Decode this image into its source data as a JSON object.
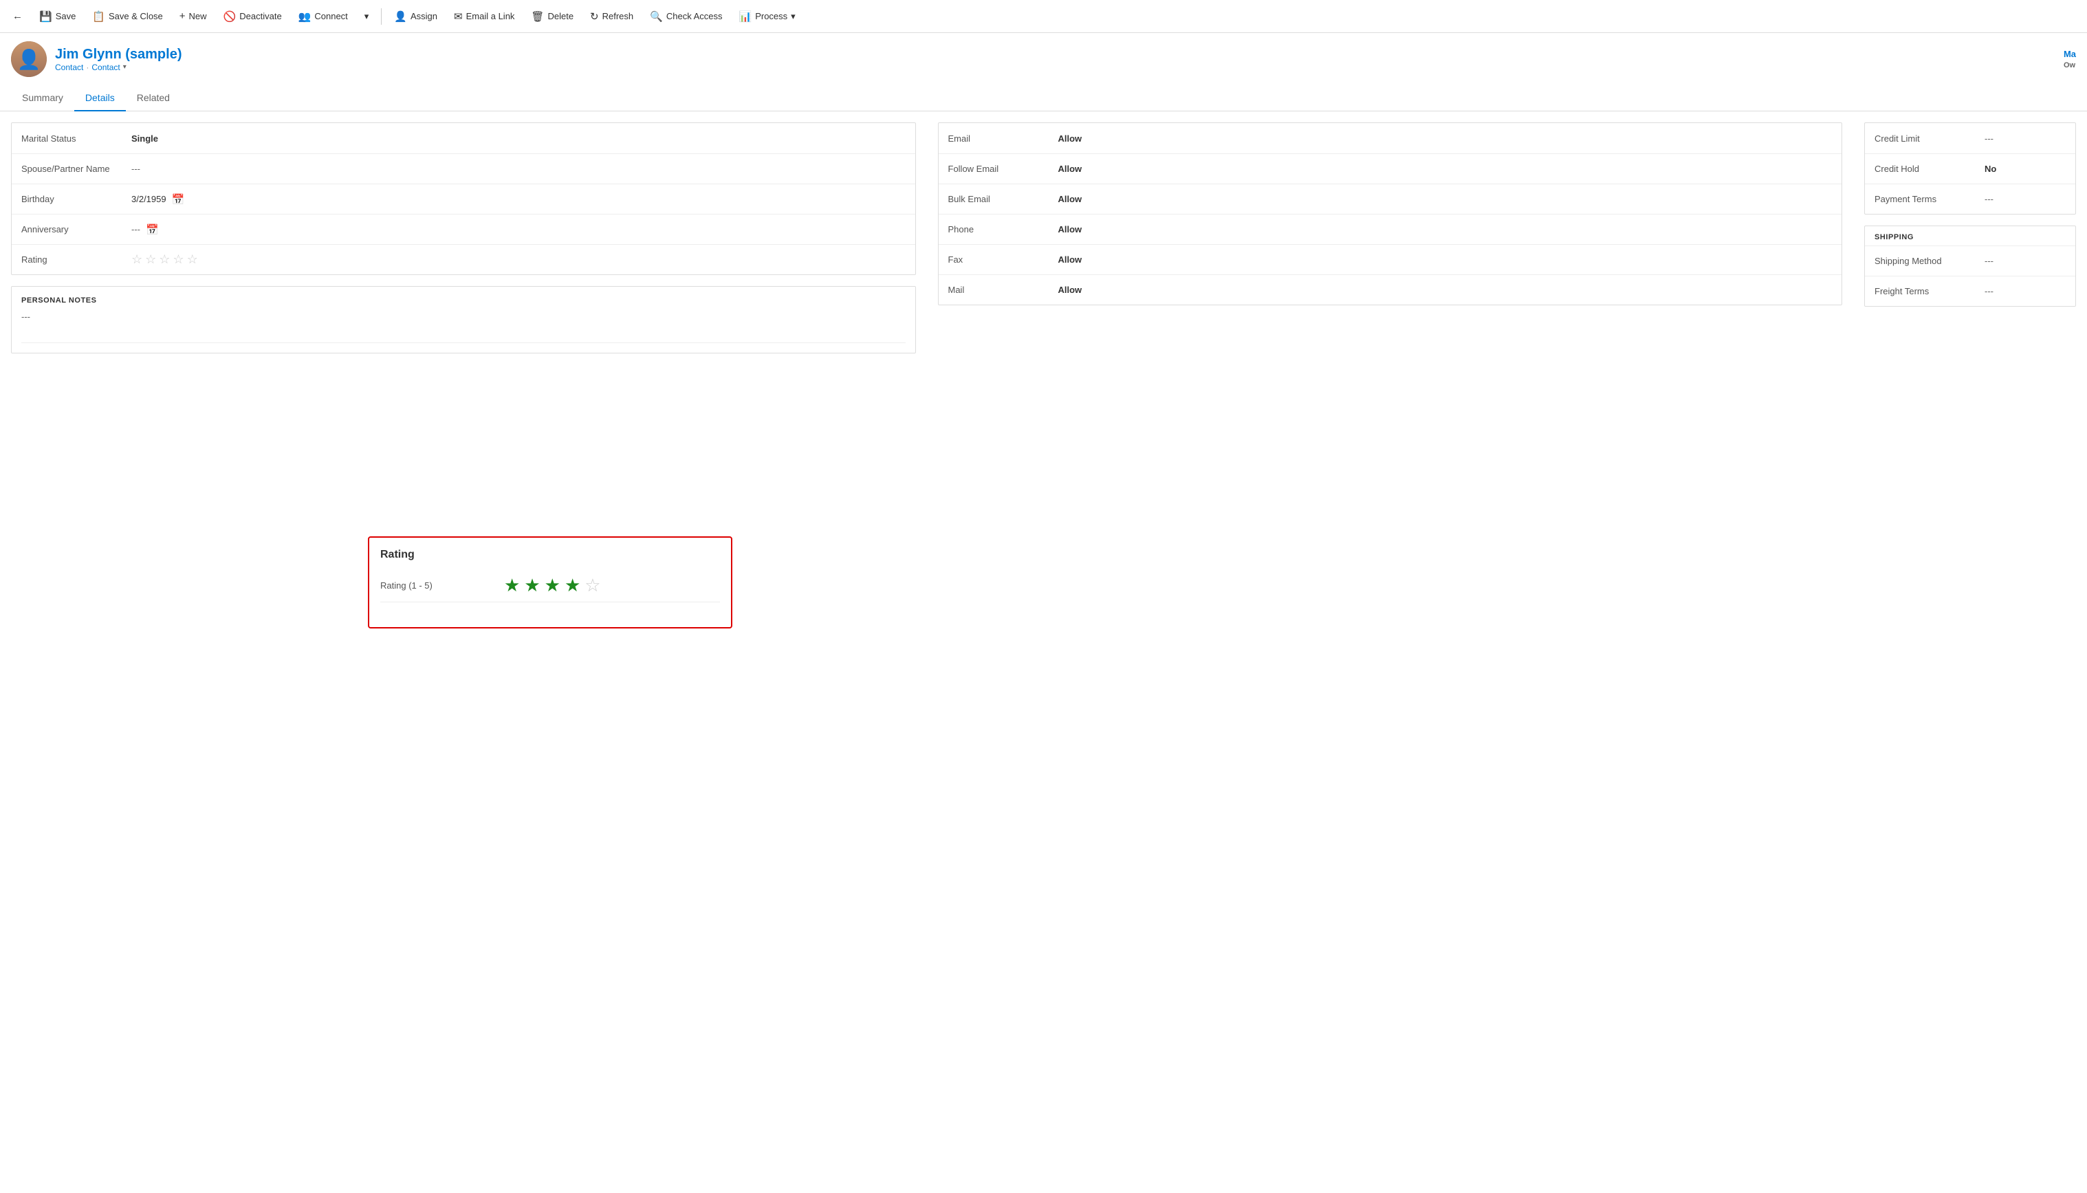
{
  "toolbar": {
    "back_label": "←",
    "save_label": "Save",
    "save_close_label": "Save & Close",
    "new_label": "New",
    "deactivate_label": "Deactivate",
    "connect_label": "Connect",
    "dropdown_label": "▾",
    "assign_label": "Assign",
    "email_link_label": "Email a Link",
    "delete_label": "Delete",
    "refresh_label": "Refresh",
    "check_access_label": "Check Access",
    "process_label": "Process",
    "process_dropdown": "▾"
  },
  "header": {
    "name": "Jim Glynn (sample)",
    "entity_type": "Contact",
    "breadcrumb": "Contact",
    "avatar_text": "👤",
    "right_label": "Ma",
    "right_sub": "Ow"
  },
  "tabs": {
    "items": [
      {
        "label": "Summary",
        "active": false
      },
      {
        "label": "Details",
        "active": true
      },
      {
        "label": "Related",
        "active": false
      }
    ]
  },
  "personal_info": {
    "fields": [
      {
        "label": "Marital Status",
        "value": "Single",
        "bold": true
      },
      {
        "label": "Spouse/Partner Name",
        "value": "---",
        "dash": true
      },
      {
        "label": "Birthday",
        "value": "3/2/1959",
        "calendar": true
      },
      {
        "label": "Anniversary",
        "value": "---",
        "dash": true,
        "calendar": true
      },
      {
        "label": "Rating",
        "value": "",
        "stars": true,
        "filled_count": 0,
        "total": 5
      }
    ]
  },
  "personal_notes": {
    "title": "PERSONAL NOTES",
    "value": "---"
  },
  "contact_preferences": {
    "fields": [
      {
        "label": "Email",
        "value": "Allow",
        "bold": true
      },
      {
        "label": "Follow Email",
        "value": "Allow",
        "bold": true
      },
      {
        "label": "Bulk Email",
        "value": "Allow",
        "bold": true
      },
      {
        "label": "Phone",
        "value": "Allow",
        "bold": true
      },
      {
        "label": "Fax",
        "value": "Allow",
        "bold": true
      },
      {
        "label": "Mail",
        "value": "Allow",
        "bold": true
      }
    ]
  },
  "billing": {
    "fields": [
      {
        "label": "Credit Limit",
        "value": "---",
        "dash": true
      },
      {
        "label": "Credit Hold",
        "value": "No",
        "bold": true
      },
      {
        "label": "Payment Terms",
        "value": "---",
        "dash": true
      }
    ]
  },
  "shipping": {
    "title": "SHIPPING",
    "fields": [
      {
        "label": "Shipping Method",
        "value": "---",
        "dash": true
      },
      {
        "label": "Freight Terms",
        "value": "---",
        "dash": true
      }
    ]
  },
  "rating_popup": {
    "title": "Rating",
    "label": "Rating (1 - 5)",
    "filled": 4,
    "total": 5
  }
}
